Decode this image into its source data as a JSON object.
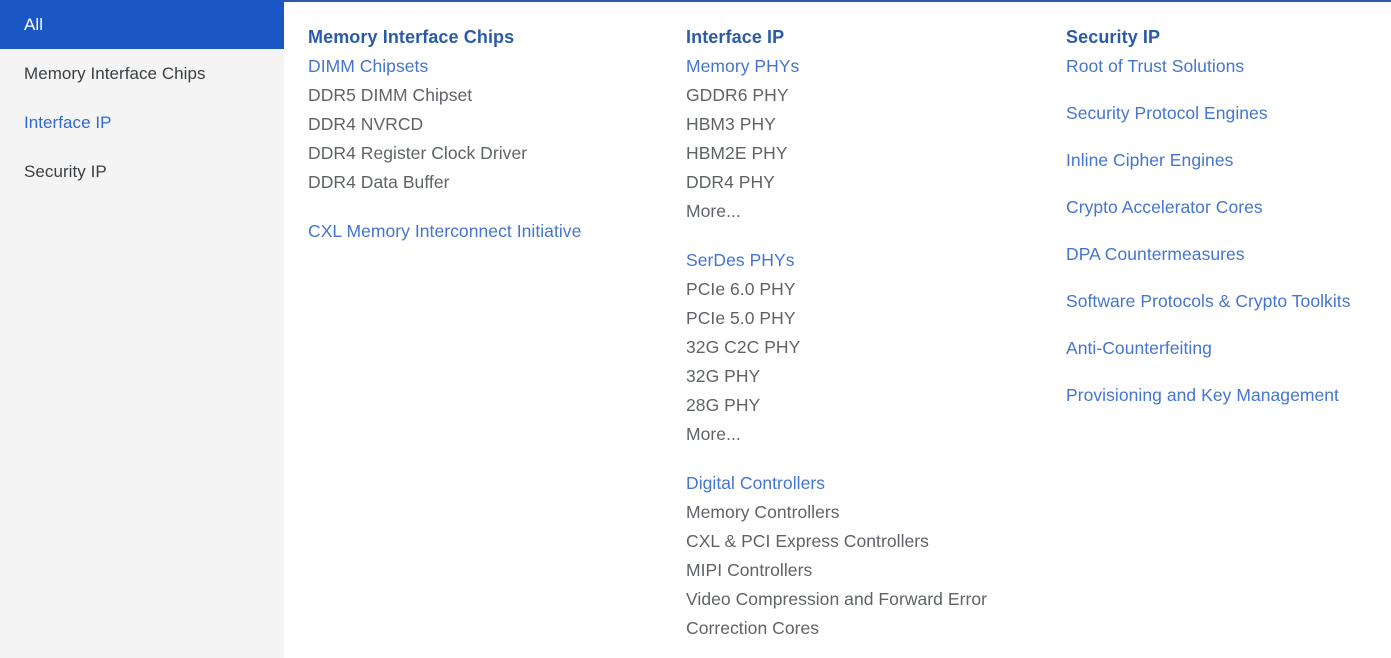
{
  "sidebar": {
    "items": [
      {
        "label": "All",
        "state": "selected"
      },
      {
        "label": "Memory Interface Chips",
        "state": "default"
      },
      {
        "label": "Interface IP",
        "state": "link"
      },
      {
        "label": "Security IP",
        "state": "default"
      }
    ]
  },
  "columns": [
    {
      "heading": "Memory Interface Chips",
      "groups": [
        {
          "subheading": "DIMM Chipsets",
          "items": [
            "DDR5 DIMM Chipset",
            "DDR4 NVRCD",
            "DDR4 Register Clock Driver",
            "DDR4 Data Buffer"
          ]
        }
      ],
      "standalone_links": [
        "CXL Memory Interconnect Initiative"
      ]
    },
    {
      "heading": "Interface IP",
      "groups": [
        {
          "subheading": "Memory PHYs",
          "items": [
            "GDDR6 PHY",
            "HBM3 PHY",
            "HBM2E PHY",
            "DDR4 PHY",
            "More..."
          ]
        },
        {
          "subheading": "SerDes PHYs",
          "items": [
            "PCIe 6.0 PHY",
            "PCIe 5.0 PHY",
            "32G C2C PHY",
            "32G PHY",
            "28G PHY",
            "More..."
          ]
        },
        {
          "subheading": "Digital Controllers",
          "items": [
            "Memory Controllers",
            "CXL & PCI Express Controllers",
            "MIPI Controllers",
            "Video Compression and Forward Error Correction Cores"
          ]
        }
      ],
      "standalone_links": []
    },
    {
      "heading": "Security IP",
      "links": [
        "Root of Trust Solutions",
        "Security Protocol Engines",
        "Inline Cipher Engines",
        "Crypto Accelerator Cores",
        "DPA Countermeasures",
        "Software Protocols & Crypto Toolkits",
        "Anti-Counterfeiting",
        "Provisioning and Key Management"
      ]
    }
  ],
  "colors": {
    "accent_blue": "#1a56c4",
    "heading_blue": "#2b5ba8",
    "link_blue": "#4575cf",
    "sidebar_link_blue": "#3367d6",
    "text_gray": "#5f6368",
    "sidebar_bg": "#f4f4f4"
  }
}
